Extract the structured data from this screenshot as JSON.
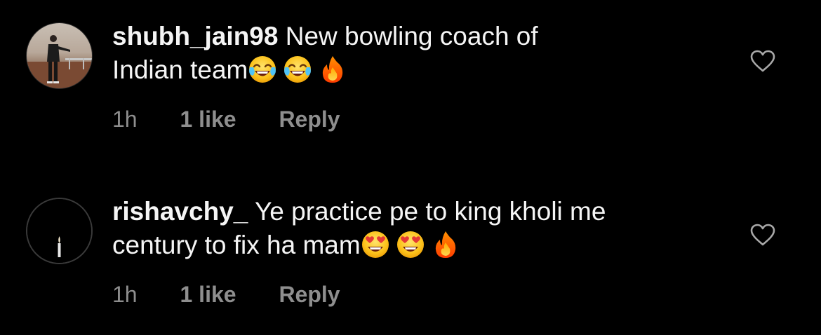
{
  "comments": [
    {
      "username": "shubh_jain98",
      "text_line1": "New bowling coach of",
      "text_line2": "Indian team",
      "emojis": [
        "face-with-tears-of-joy-icon",
        "face-with-tears-of-joy-icon",
        "fire-icon"
      ],
      "time": "1h",
      "likes": "1 like",
      "reply": "Reply"
    },
    {
      "username": "rishavchy_",
      "text_line1": "Ye practice pe to king kholi me",
      "text_line2": "century to fix ha mam",
      "emojis": [
        "smiling-face-with-heart-eyes-icon",
        "smiling-face-with-heart-eyes-icon",
        "fire-icon"
      ],
      "time": "1h",
      "likes": "1 like",
      "reply": "Reply"
    }
  ],
  "colors": {
    "background": "#000000",
    "text": "#f5f5f5",
    "meta": "#8e8e8e"
  }
}
